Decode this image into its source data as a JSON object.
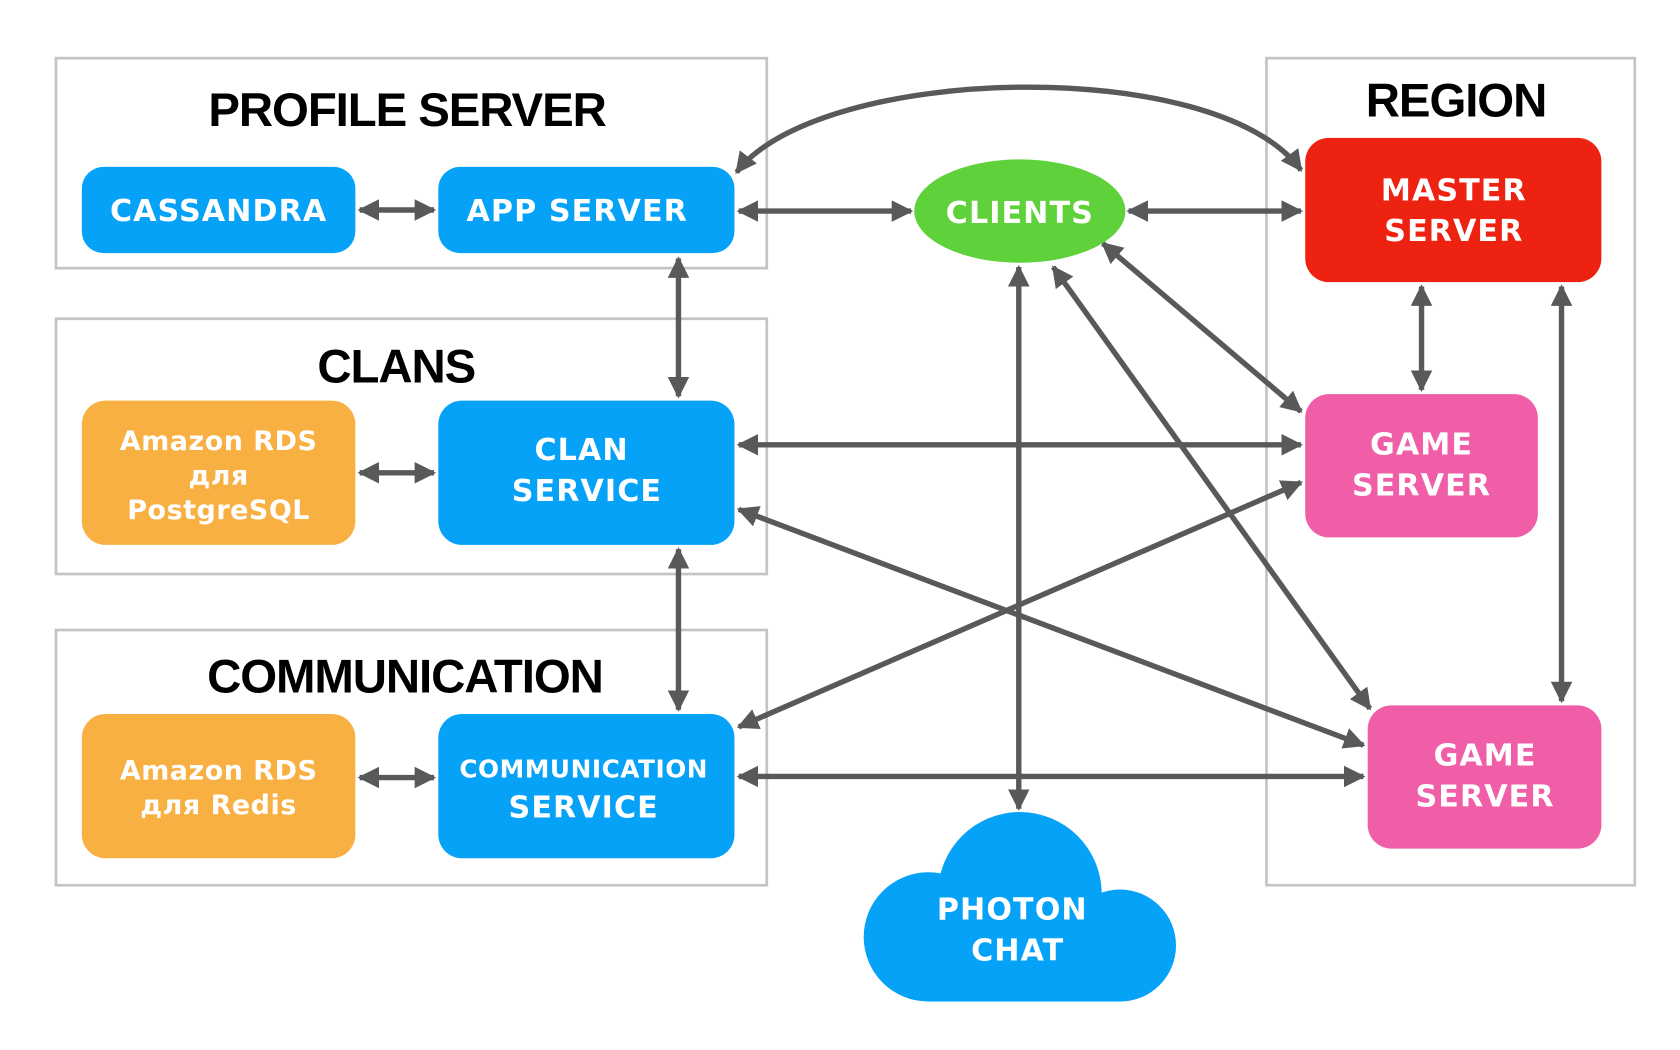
{
  "colors": {
    "blue": "#05a2f7",
    "green": "#5fd13a",
    "red": "#ee2211",
    "pink": "#ef5ea6",
    "orange": "#f8b043",
    "arrow": "#58595b",
    "group_border": "#c4c4c6"
  },
  "groups": {
    "profile": {
      "title": "PROFILE SERVER"
    },
    "clans": {
      "title": "CLANS"
    },
    "communication": {
      "title": "COMMUNICATION"
    },
    "region": {
      "title": "REGION"
    }
  },
  "nodes": {
    "cassandra": {
      "lines": [
        "CASSANDRA"
      ]
    },
    "app_server": {
      "lines": [
        "APP SERVER"
      ]
    },
    "clients": {
      "lines": [
        "CLIENTS"
      ]
    },
    "master_server": {
      "lines": [
        "MASTER",
        "SERVER"
      ]
    },
    "game_server_1": {
      "lines": [
        "GAME",
        "SERVER"
      ]
    },
    "rds_postgres": {
      "lines": [
        "Amazon RDS",
        "для",
        "PostgreSQL"
      ]
    },
    "clan_service": {
      "lines": [
        "CLAN",
        "SERVICE"
      ]
    },
    "rds_redis": {
      "lines": [
        "Amazon RDS",
        "для Redis"
      ]
    },
    "communication_service": {
      "lines": [
        "COMMUNICATION",
        "SERVICE"
      ]
    },
    "game_server_2": {
      "lines": [
        "GAME",
        "SERVER"
      ]
    },
    "photon_chat": {
      "lines": [
        "PHOTON",
        "CHAT"
      ]
    }
  },
  "connections": [
    [
      "cassandra",
      "app_server"
    ],
    [
      "app_server",
      "clients"
    ],
    [
      "clients",
      "master_server"
    ],
    [
      "app_server",
      "master_server"
    ],
    [
      "app_server",
      "clan_service"
    ],
    [
      "clan_service",
      "communication_service"
    ],
    [
      "rds_postgres",
      "clan_service"
    ],
    [
      "rds_redis",
      "communication_service"
    ],
    [
      "clan_service",
      "game_server_1"
    ],
    [
      "clan_service",
      "game_server_2"
    ],
    [
      "communication_service",
      "game_server_1"
    ],
    [
      "communication_service",
      "game_server_2"
    ],
    [
      "clients",
      "photon_chat"
    ],
    [
      "clients",
      "game_server_1"
    ],
    [
      "clients",
      "game_server_2"
    ],
    [
      "master_server",
      "game_server_1"
    ],
    [
      "master_server",
      "game_server_2"
    ]
  ]
}
